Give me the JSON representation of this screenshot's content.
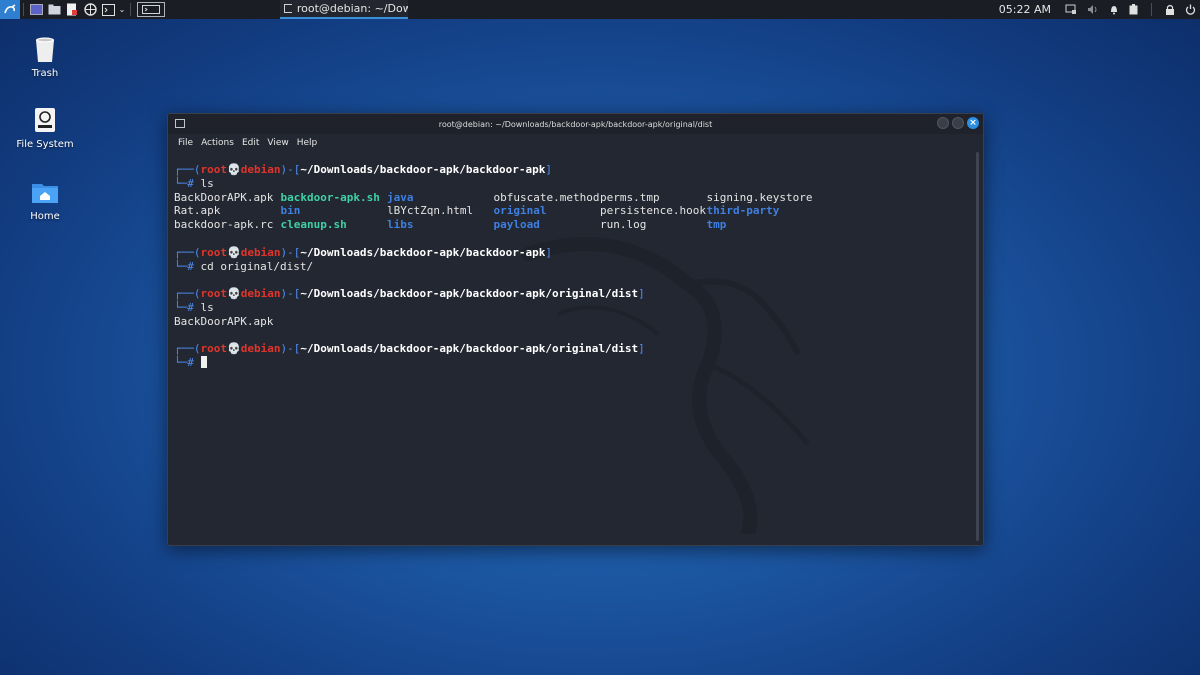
{
  "panel": {
    "task_title": "root@debian: ~/Downlo...",
    "clock": "05:22 AM",
    "launchers": [
      "desktop-icon",
      "file-manager-icon",
      "text-editor-icon",
      "web-browser-icon",
      "terminal-icon"
    ]
  },
  "desktop": {
    "icons": [
      {
        "label": "Trash"
      },
      {
        "label": "File System"
      },
      {
        "label": "Home"
      }
    ]
  },
  "terminal": {
    "title": "root@debian: ~/Downloads/backdoor-apk/backdoor-apk/original/dist",
    "menu": [
      "File",
      "Actions",
      "Edit",
      "View",
      "Help"
    ],
    "user": "root",
    "host": "debian",
    "prompt_symbol": "#",
    "blocks": [
      {
        "cwd": "~/Downloads/backdoor-apk/backdoor-apk",
        "command": "ls",
        "ls_rows": [
          [
            {
              "name": "BackDoorAPK.apk",
              "kind": "file"
            },
            {
              "name": "backdoor-apk.sh",
              "kind": "exe"
            },
            {
              "name": "java",
              "kind": "dir"
            },
            {
              "name": "obfuscate.method",
              "kind": "file"
            },
            {
              "name": "perms.tmp",
              "kind": "file"
            },
            {
              "name": "signing.keystore",
              "kind": "file"
            }
          ],
          [
            {
              "name": "Rat.apk",
              "kind": "file"
            },
            {
              "name": "bin",
              "kind": "dir"
            },
            {
              "name": "lBYctZqn.html",
              "kind": "file"
            },
            {
              "name": "original",
              "kind": "dir"
            },
            {
              "name": "persistence.hook",
              "kind": "file"
            },
            {
              "name": "third-party",
              "kind": "dir"
            }
          ],
          [
            {
              "name": "backdoor-apk.rc",
              "kind": "file"
            },
            {
              "name": "cleanup.sh",
              "kind": "exe"
            },
            {
              "name": "libs",
              "kind": "dir"
            },
            {
              "name": "payload",
              "kind": "dir"
            },
            {
              "name": "run.log",
              "kind": "file"
            },
            {
              "name": "tmp",
              "kind": "dir"
            }
          ]
        ]
      },
      {
        "cwd": "~/Downloads/backdoor-apk/backdoor-apk",
        "command": "cd original/dist/",
        "output": ""
      },
      {
        "cwd": "~/Downloads/backdoor-apk/backdoor-apk/original/dist",
        "command": "ls",
        "output": "BackDoorAPK.apk"
      },
      {
        "cwd": "~/Downloads/backdoor-apk/backdoor-apk/original/dist",
        "command": "",
        "active": true
      }
    ]
  },
  "colors": {
    "prompt_frame": "#4f8ff7",
    "user_host": "#e0352b",
    "directory": "#3e7fe0",
    "executable": "#3fd0a5",
    "terminal_bg": "#232731"
  }
}
